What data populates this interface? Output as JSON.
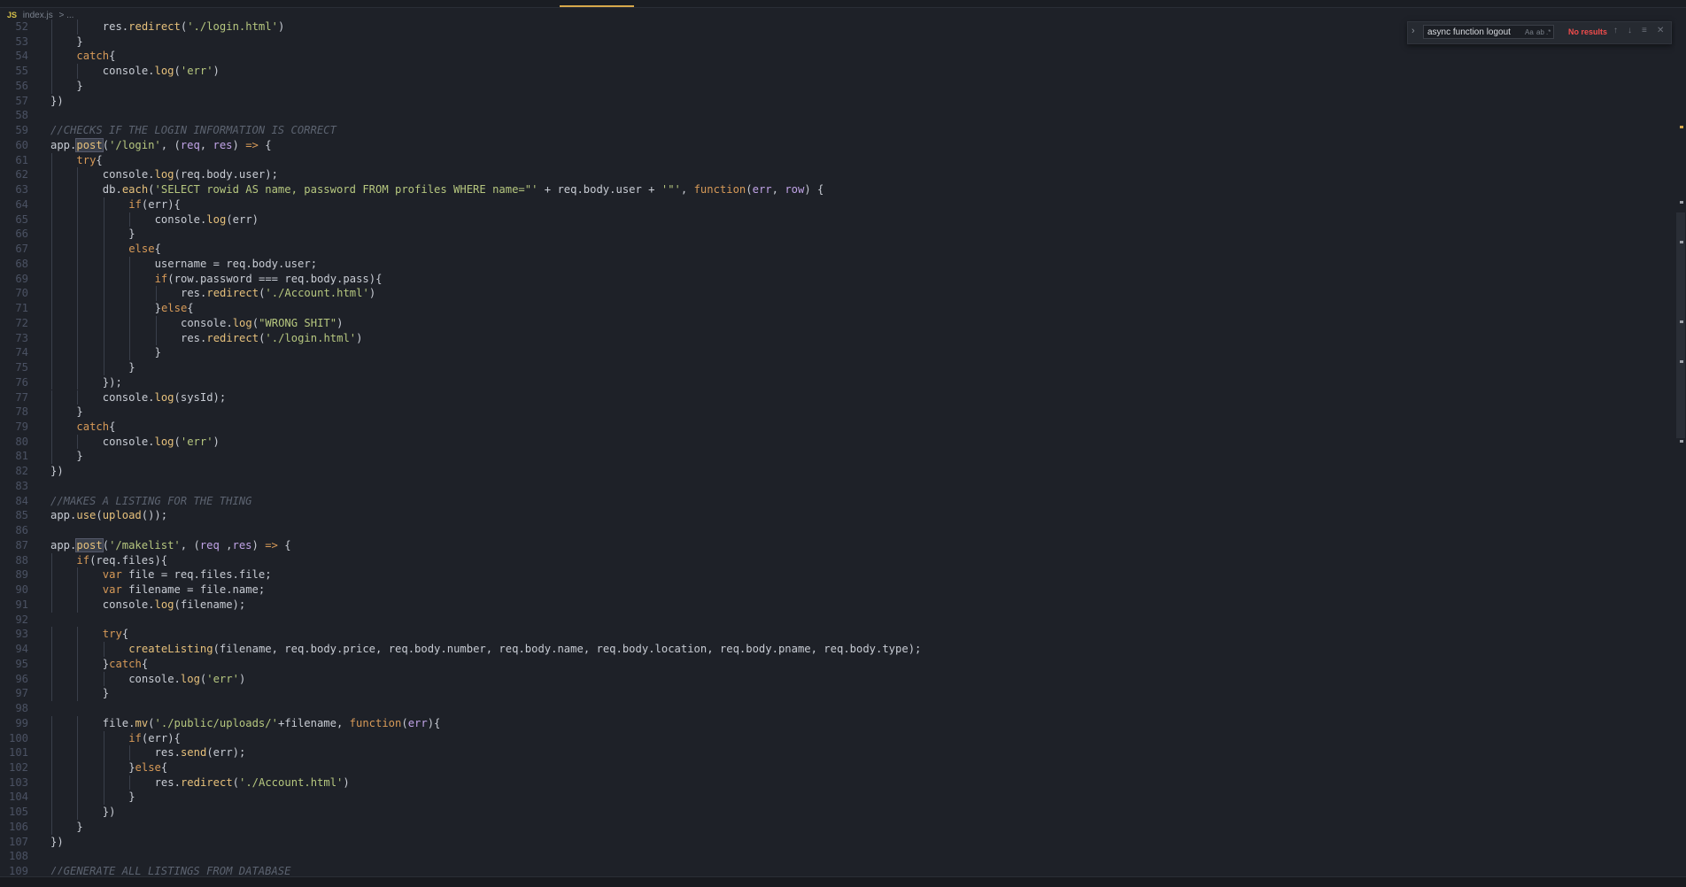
{
  "breadcrumb": {
    "badge": "JS",
    "file": "index.js",
    "more": ">  ..."
  },
  "find": {
    "query": "async function logout",
    "match_case": "Aa",
    "whole_word": "ab",
    "regex": ".*",
    "result": "No results"
  },
  "lines": [
    {
      "n": "52",
      "indent": 2,
      "html": "res.<span class=f>redirect</span>(<span class=s>'./login.html'</span>)"
    },
    {
      "n": "53",
      "indent": 1,
      "html": "}"
    },
    {
      "n": "54",
      "indent": 1,
      "html": "<span class=k>catch</span>{"
    },
    {
      "n": "55",
      "indent": 2,
      "html": "console.<span class=f>log</span>(<span class=s>'err'</span>)"
    },
    {
      "n": "56",
      "indent": 1,
      "html": "}"
    },
    {
      "n": "57",
      "indent": 0,
      "html": "})"
    },
    {
      "n": "58",
      "indent": 0,
      "html": ""
    },
    {
      "n": "59",
      "indent": 0,
      "html": "<span class=c>//CHECKS IF THE LOGIN INFORMATION IS CORRECT</span>"
    },
    {
      "n": "60",
      "indent": 0,
      "html": "app.<span class='f hl'>post</span>(<span class=s>'/login'</span>, (<span class=v>req</span>, <span class=v>res</span>) <span class=k>=&gt;</span> {"
    },
    {
      "n": "61",
      "indent": 1,
      "html": "<span class=k>try</span>{"
    },
    {
      "n": "62",
      "indent": 2,
      "html": "console.<span class=f>log</span>(req.body.user);"
    },
    {
      "n": "63",
      "indent": 2,
      "html": "db.<span class=f>each</span>(<span class=s>'SELECT rowid AS name, password FROM profiles WHERE name=\"'</span> + req.body.user + <span class=s>'\"'</span>, <span class=k>function</span>(<span class=v>err</span>, <span class=v>row</span>) {"
    },
    {
      "n": "64",
      "indent": 3,
      "html": "<span class=k>if</span>(err){"
    },
    {
      "n": "65",
      "indent": 4,
      "html": "console.<span class=f>log</span>(err)"
    },
    {
      "n": "66",
      "indent": 3,
      "html": "}"
    },
    {
      "n": "67",
      "indent": 3,
      "html": "<span class=k>else</span>{"
    },
    {
      "n": "68",
      "indent": 4,
      "html": "username = req.body.user;"
    },
    {
      "n": "69",
      "indent": 4,
      "html": "<span class=k>if</span>(row.password === req.body.pass){"
    },
    {
      "n": "70",
      "indent": 5,
      "html": "res.<span class=f>redirect</span>(<span class=s>'./Account.html'</span>)"
    },
    {
      "n": "71",
      "indent": 4,
      "html": "}<span class=k>else</span>{"
    },
    {
      "n": "72",
      "indent": 5,
      "html": "console.<span class=f>log</span>(<span class=s>\"WRONG SHIT\"</span>)"
    },
    {
      "n": "73",
      "indent": 5,
      "html": "res.<span class=f>redirect</span>(<span class=s>'./login.html'</span>)"
    },
    {
      "n": "74",
      "indent": 4,
      "html": "}"
    },
    {
      "n": "75",
      "indent": 3,
      "html": "}"
    },
    {
      "n": "76",
      "indent": 2,
      "html": "});"
    },
    {
      "n": "77",
      "indent": 2,
      "html": "console.<span class=f>log</span>(sysId);"
    },
    {
      "n": "78",
      "indent": 1,
      "html": "}"
    },
    {
      "n": "79",
      "indent": 1,
      "html": "<span class=k>catch</span>{"
    },
    {
      "n": "80",
      "indent": 2,
      "html": "console.<span class=f>log</span>(<span class=s>'err'</span>)"
    },
    {
      "n": "81",
      "indent": 1,
      "html": "}"
    },
    {
      "n": "82",
      "indent": 0,
      "html": "})"
    },
    {
      "n": "83",
      "indent": 0,
      "html": ""
    },
    {
      "n": "84",
      "indent": 0,
      "html": "<span class=c>//MAKES A LISTING FOR THE THING</span>"
    },
    {
      "n": "85",
      "indent": 0,
      "html": "app.<span class=f>use</span>(<span class=f>upload</span>());"
    },
    {
      "n": "86",
      "indent": 0,
      "html": ""
    },
    {
      "n": "87",
      "indent": 0,
      "html": "app.<span class='f hl'>post</span>(<span class=s>'/makelist'</span>, (<span class=v>req</span> ,<span class=v>res</span>) <span class=k>=&gt;</span> {"
    },
    {
      "n": "88",
      "indent": 1,
      "html": "<span class=k>if</span>(req.files){"
    },
    {
      "n": "89",
      "indent": 2,
      "html": "<span class=k>var</span> file = req.files.file;"
    },
    {
      "n": "90",
      "indent": 2,
      "html": "<span class=k>var</span> filename = file.name;"
    },
    {
      "n": "91",
      "indent": 2,
      "html": "console.<span class=f>log</span>(filename);"
    },
    {
      "n": "92",
      "indent": 0,
      "html": ""
    },
    {
      "n": "93",
      "indent": 2,
      "html": "<span class=k>try</span>{"
    },
    {
      "n": "94",
      "indent": 3,
      "html": "<span class=f>createListing</span>(filename, req.body.price, req.body.number, req.body.name, req.body.location, req.body.pname, req.body.type);"
    },
    {
      "n": "95",
      "indent": 2,
      "html": "}<span class=k>catch</span>{"
    },
    {
      "n": "96",
      "indent": 3,
      "html": "console.<span class=f>log</span>(<span class=s>'err'</span>)"
    },
    {
      "n": "97",
      "indent": 2,
      "html": "}"
    },
    {
      "n": "98",
      "indent": 0,
      "html": ""
    },
    {
      "n": "99",
      "indent": 2,
      "html": "file.<span class=f>mv</span>(<span class=s>'./public/uploads/'</span>+filename, <span class=k>function</span>(<span class=v>err</span>){"
    },
    {
      "n": "100",
      "indent": 3,
      "html": "<span class=k>if</span>(err){"
    },
    {
      "n": "101",
      "indent": 4,
      "html": "res.<span class=f>send</span>(err);"
    },
    {
      "n": "102",
      "indent": 3,
      "html": "}<span class=k>else</span>{"
    },
    {
      "n": "103",
      "indent": 4,
      "html": "res.<span class=f>redirect</span>(<span class=s>'./Account.html'</span>)"
    },
    {
      "n": "104",
      "indent": 3,
      "html": "}"
    },
    {
      "n": "105",
      "indent": 2,
      "html": "})"
    },
    {
      "n": "106",
      "indent": 1,
      "html": "}"
    },
    {
      "n": "107",
      "indent": 0,
      "html": "})"
    },
    {
      "n": "108",
      "indent": 0,
      "html": ""
    },
    {
      "n": "109",
      "indent": 0,
      "html": "<span class=c>//GENERATE ALL LISTINGS FROM DATABASE</span>"
    }
  ]
}
